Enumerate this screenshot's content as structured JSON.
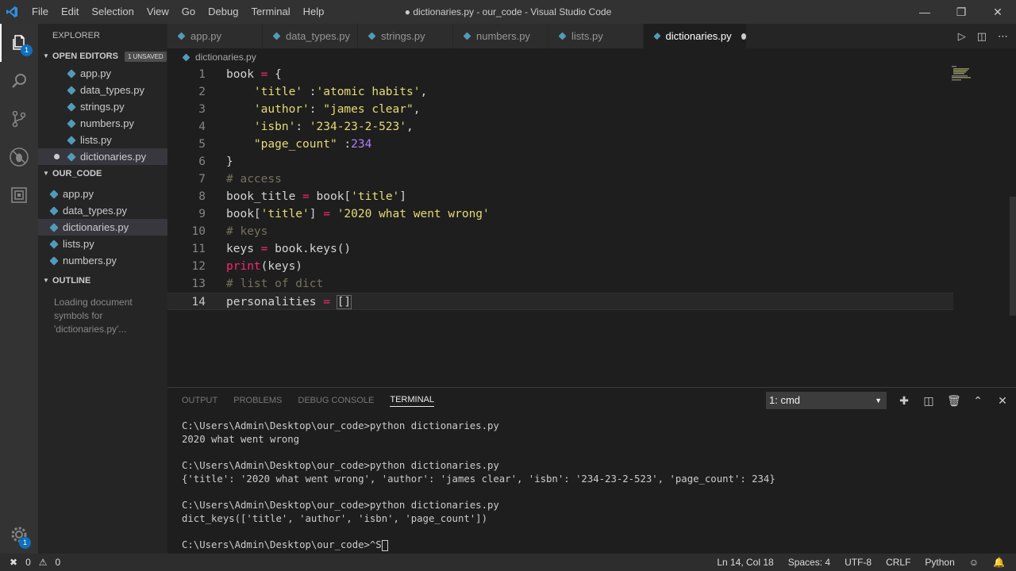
{
  "window": {
    "title": "● dictionaries.py - our_code - Visual Studio Code",
    "menu": [
      "File",
      "Edit",
      "Selection",
      "View",
      "Go",
      "Debug",
      "Terminal",
      "Help"
    ]
  },
  "activity": {
    "explorer_badge": "1",
    "settings_badge": "1"
  },
  "sidebar": {
    "title": "EXPLORER",
    "open_editors": {
      "label": "OPEN EDITORS",
      "badge": "1 UNSAVED",
      "files": [
        "app.py",
        "data_types.py",
        "strings.py",
        "numbers.py",
        "lists.py",
        "dictionaries.py"
      ]
    },
    "folder": {
      "label": "OUR_CODE",
      "files": [
        "app.py",
        "data_types.py",
        "dictionaries.py",
        "lists.py",
        "numbers.py"
      ]
    },
    "outline": {
      "label": "OUTLINE",
      "message_lines": [
        "Loading document",
        "symbols for",
        "'dictionaries.py'..."
      ]
    }
  },
  "tabs": [
    "app.py",
    "data_types.py",
    "strings.py",
    "numbers.py",
    "lists.py",
    "dictionaries.py"
  ],
  "breadcrumb": "dictionaries.py",
  "editor": {
    "line_numbers": [
      "1",
      "2",
      "3",
      "4",
      "5",
      "6",
      "7",
      "8",
      "9",
      "10",
      "11",
      "12",
      "13",
      "14"
    ],
    "code": {
      "l1a": "book",
      "l1b": " = ",
      "l1c": "{",
      "l2a": "    ",
      "l2b": "'title'",
      "l2c": " :",
      "l2d": "'atomic habits'",
      "l2e": ",",
      "l3a": "    ",
      "l3b": "'author'",
      "l3c": ": ",
      "l3d": "\"james clear\"",
      "l3e": ",",
      "l4a": "    ",
      "l4b": "'isbn'",
      "l4c": ": ",
      "l4d": "'234-23-2-523'",
      "l4e": ",",
      "l5a": "    ",
      "l5b": "\"page_count\"",
      "l5c": " :",
      "l5d": "234",
      "l6": "}",
      "l7": "# access",
      "l8a": "book_title",
      "l8b": " = ",
      "l8c": "book[",
      "l8d": "'title'",
      "l8e": "]",
      "l9a": "book[",
      "l9b": "'title'",
      "l9c": "]",
      "l9d": " = ",
      "l9e": "'2020 what went wrong'",
      "l10": "# keys",
      "l11a": "keys",
      "l11b": " = ",
      "l11c": "book.keys()",
      "l12a": "print",
      "l12b": "(keys)",
      "l13": "# list of dict",
      "l14a": "personalities",
      "l14b": " = ",
      "l14c": "[]"
    }
  },
  "panel": {
    "tabs": [
      "OUTPUT",
      "PROBLEMS",
      "DEBUG CONSOLE",
      "TERMINAL"
    ],
    "terminal_select": "1: cmd",
    "terminal_lines": [
      "C:\\Users\\Admin\\Desktop\\our_code>python dictionaries.py",
      "2020 what went wrong",
      "",
      "C:\\Users\\Admin\\Desktop\\our_code>python dictionaries.py",
      "{'title': '2020 what went wrong', 'author': 'james clear', 'isbn': '234-23-2-523', 'page_count': 234}",
      "",
      "C:\\Users\\Admin\\Desktop\\our_code>python dictionaries.py",
      "dict_keys(['title', 'author', 'isbn', 'page_count'])",
      "",
      "C:\\Users\\Admin\\Desktop\\our_code>^S"
    ]
  },
  "status": {
    "errors": "0",
    "warnings": "0",
    "position": "Ln 14, Col 18",
    "spaces": "Spaces: 4",
    "encoding": "UTF-8",
    "eol": "CRLF",
    "language": "Python"
  }
}
